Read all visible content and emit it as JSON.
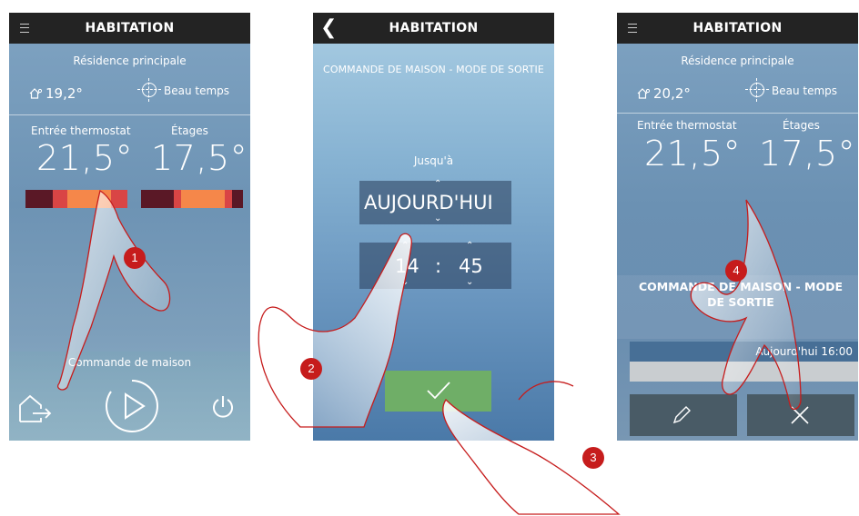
{
  "screen1": {
    "header_title": "HABITATION",
    "residence": "Résidence principale",
    "outdoor_temp": "19,2°",
    "weather": "Beau temps",
    "zone1_label": "Entrée thermostat",
    "zone1_value": "21,5°",
    "zone2_label": "Étages",
    "zone2_value": "17,5°",
    "command_label": "Commande de maison"
  },
  "screen2": {
    "header_title": "HABITATION",
    "title": "COMMANDE DE MAISON - MODE DE SORTIE",
    "until_label": "Jusqu'à",
    "day_value": "AUJOURD'HUI",
    "hour": "14",
    "separator": ":",
    "minute": "45"
  },
  "screen3": {
    "header_title": "HABITATION",
    "residence": "Résidence principale",
    "outdoor_temp": "20,2°",
    "weather": "Beau temps",
    "zone1_label": "Entrée thermostat",
    "zone1_value": "21,5°",
    "zone2_label": "Étages",
    "zone2_value": "17,5°",
    "mode_text": "COMMANDE DE MAISON - MODE DE SORTIE",
    "until_text": "Aujourd'hui 16:00"
  },
  "markers": [
    "1",
    "2",
    "3",
    "4"
  ],
  "colors": {
    "header": "#232323",
    "marker": "#c61c1c",
    "confirm": "#6fae67",
    "bar_dark": "#5a1826",
    "bar_red": "#d94545",
    "bar_orange": "#f5874a"
  }
}
